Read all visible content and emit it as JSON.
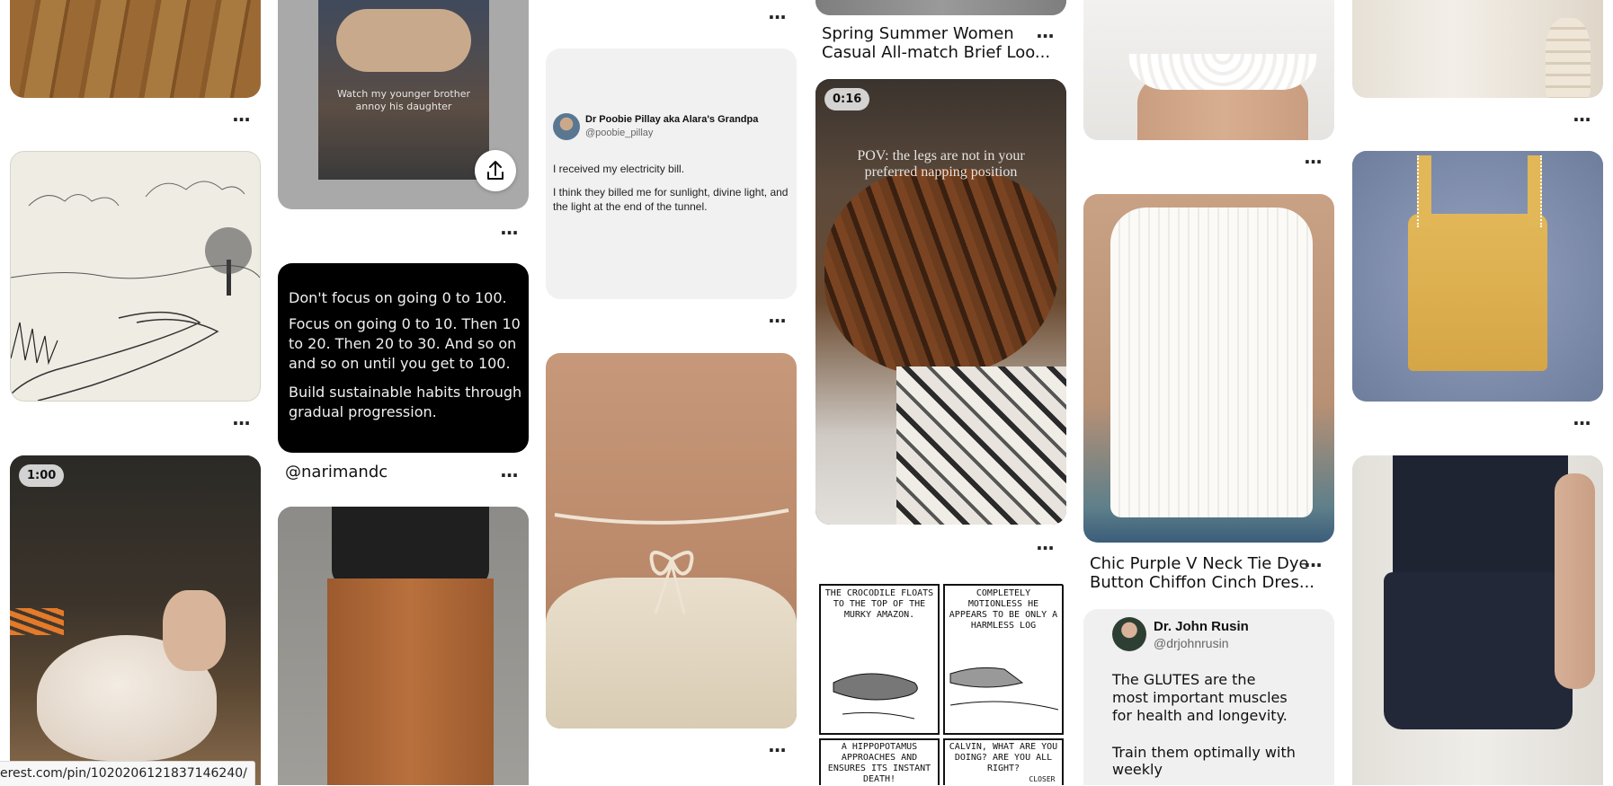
{
  "overflow_label": "···",
  "pins": {
    "bro": {
      "caption_line1": "Watch my younger brother",
      "caption_line2": "annoy his daughter"
    },
    "tweet": {
      "author": "Dr Poobie Pillay aka Alara's Grandpa",
      "handle": "@poobie_pillay",
      "line1": "I received my electricity bill.",
      "line2": "I think they billed me for sunlight, divine light, and the light at the end of the tunnel."
    },
    "quote": {
      "p1": "Don't focus on going 0 to 100.",
      "p2": "Focus on going 0 to 10. Then 10 to 20. Then 20 to 30. And so on and so on until you get to 100.",
      "p3": "Build sustainable habits through gradual progression.",
      "author": "@narimandc"
    },
    "spring": {
      "title_line1": "Spring Summer Women",
      "title_line2": "Casual All-match Brief Loo..."
    },
    "dog": {
      "duration": "0:16",
      "overlay_line1": "POV: the legs are not in your",
      "overlay_line2": "preferred napping position"
    },
    "chic": {
      "title_line1": "Chic Purple V Neck Tie Dye",
      "title_line2": "Button Chiffon Cinch Dres..."
    },
    "rusin": {
      "name": "Dr. John Rusin",
      "handle": "@drjohnrusin",
      "l1": "The GLUTES are the",
      "l2": "most important muscles",
      "l3": "for health and longevity.",
      "l4": "Train them optimally with weekly"
    },
    "chicken": {
      "duration": "1:00"
    },
    "comic": {
      "p1": "THE CROCODILE FLOATS TO THE TOP OF THE MURKY AMAZON.",
      "p2": "COMPLETELY MOTIONLESS HE APPEARS TO BE ONLY A HARMLESS LOG",
      "p3": "A HIPPOPOTAMUS APPROACHES AND ENSURES ITS INSTANT DEATH!",
      "p4": "CALVIN, WHAT ARE YOU DOING? ARE YOU ALL RIGHT?",
      "p4b": "CLOSER"
    }
  },
  "status_url": "erest.com/pin/1020206121837146240/"
}
